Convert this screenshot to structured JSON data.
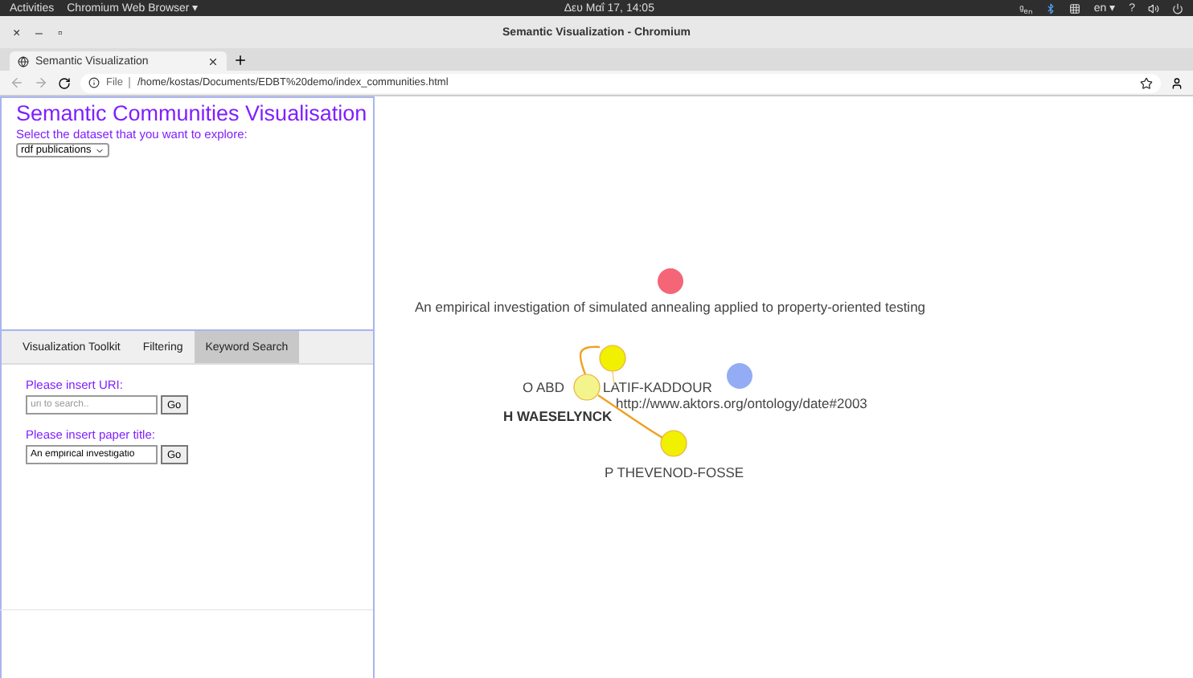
{
  "system_bar": {
    "activities": "Activities",
    "app": "Chromium Web Browser ▾",
    "clock": "Δευ Μαΐ 17, 14:05",
    "input_method": "ᵍₑₙ",
    "language": "en ▾",
    "help": "?"
  },
  "window": {
    "title": "Semantic Visualization - Chromium",
    "controls": [
      "×",
      "–",
      "▫"
    ]
  },
  "browser_tabs": [
    {
      "label": "Semantic Visualization",
      "selected": true
    }
  ],
  "address_bar": {
    "scheme": "File",
    "url": "/home/kostas/Documents/EDBT%20demo/index_communities.html"
  },
  "page": {
    "heading": "Semantic Communities Visualisation",
    "dataset_prompt": "Select the dataset that you want to explore:",
    "dataset": "rdf publications",
    "tabs": [
      {
        "label": "Visualization Toolkit",
        "selected": false
      },
      {
        "label": "Filtering",
        "selected": false
      },
      {
        "label": "Keyword Search",
        "selected": true
      }
    ],
    "uri_label": "Please insert URI:",
    "uri_field": {
      "placeholder": "uri to search.."
    },
    "uri_button": "Go",
    "title_label": "Please insert paper title:",
    "title_field": {
      "value": "An empirical investigatio"
    },
    "title_button": "Go"
  },
  "graph": {
    "nodes": [
      {
        "color": "#f46577"
      },
      {
        "color": "#f0f000"
      },
      {
        "color": "#f4f48c"
      },
      {
        "color": "#f0f000"
      },
      {
        "color": "#94acf4"
      }
    ],
    "labels": [
      {
        "text": "An empirical investigation of simulated annealing applied to property-oriented testing",
        "emphasis": false
      },
      {
        "text": "O ABD",
        "emphasis": false
      },
      {
        "text": "LATIF-KADDOUR",
        "emphasis": false
      },
      {
        "text": "http://www.aktors.org/ontology/date#2003",
        "emphasis": false
      },
      {
        "text": "H WAESELYNCK",
        "emphasis": true
      },
      {
        "text": "P THEVENOD-FOSSE",
        "emphasis": false
      }
    ]
  }
}
